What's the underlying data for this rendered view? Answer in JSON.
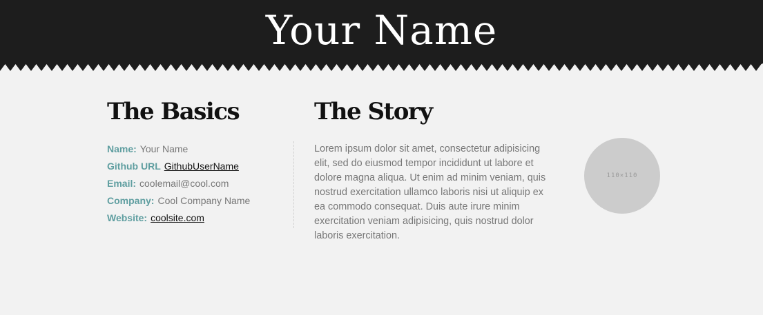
{
  "header": {
    "title": "Your Name"
  },
  "basics": {
    "title": "The Basics",
    "items": [
      {
        "label": "Name:",
        "value": "Your Name",
        "is_link": false
      },
      {
        "label": "Github URL",
        "value": "GithubUserName",
        "is_link": true
      },
      {
        "label": "Email:",
        "value": "coolemail@cool.com",
        "is_link": false
      },
      {
        "label": "Company:",
        "value": "Cool Company Name",
        "is_link": false
      },
      {
        "label": "Website:",
        "value": "coolsite.com",
        "is_link": true
      }
    ]
  },
  "story": {
    "title": "The Story",
    "text": "Lorem ipsum dolor sit amet, consectetur adipisicing elit, sed do eiusmod tempor incididunt ut labore et dolore magna aliqua. Ut enim ad minim veniam, quis nostrud exercitation ullamco laboris nisi ut aliquip ex ea commodo consequat. Duis aute irure minim exercitation veniam adipisicing, quis nostrud dolor laboris exercitation."
  },
  "avatar": {
    "placeholder_label": "110×110"
  },
  "colors": {
    "header_background": "#1d1d1d",
    "page_background": "#f2f2f2",
    "label_accent": "#5f9ea0",
    "body_text": "#777777"
  }
}
